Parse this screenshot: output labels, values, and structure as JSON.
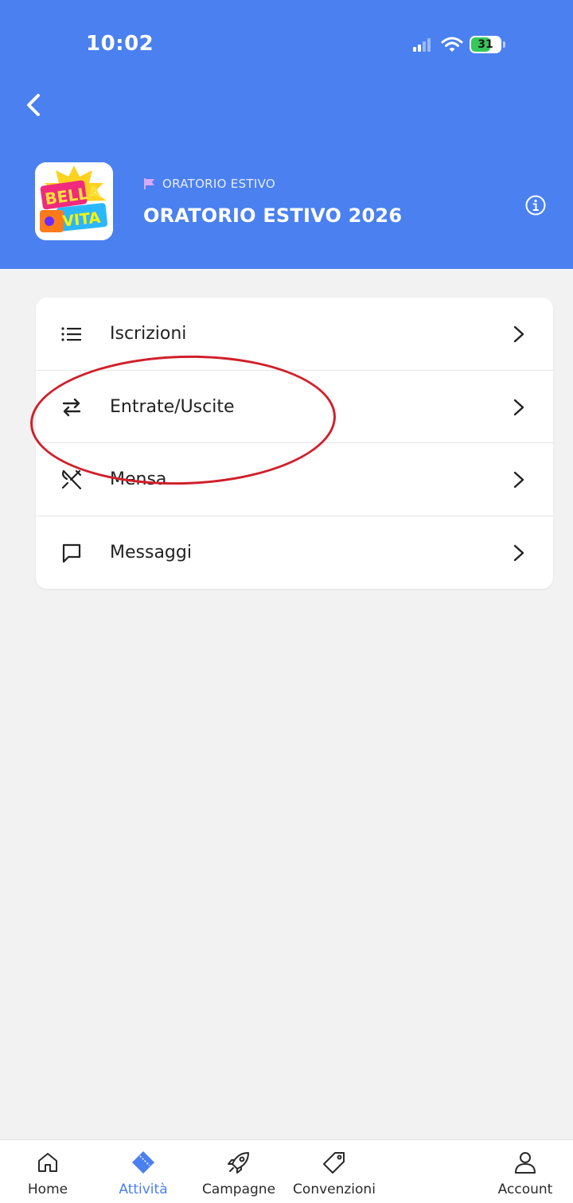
{
  "status_bar": {
    "time": "10:02",
    "battery": "31"
  },
  "header": {
    "org_label": "ORATORIO ESTIVO",
    "title": "ORATORIO ESTIVO 2026",
    "logo_text": "BELLA VITA"
  },
  "menu": {
    "items": [
      {
        "label": "Iscrizioni",
        "icon": "list-icon"
      },
      {
        "label": "Entrate/Uscite",
        "icon": "swap-arrows-icon"
      },
      {
        "label": "Mensa",
        "icon": "cutlery-icon"
      },
      {
        "label": "Messaggi",
        "icon": "message-icon"
      }
    ]
  },
  "bottom_nav": {
    "items": [
      {
        "label": "Home",
        "icon": "home-icon"
      },
      {
        "label": "Attività",
        "icon": "ticket-icon",
        "active": true
      },
      {
        "label": "Campagne",
        "icon": "rocket-icon"
      },
      {
        "label": "Convenzioni",
        "icon": "tag-icon"
      },
      {
        "label": "Account",
        "icon": "user-icon"
      }
    ]
  },
  "colors": {
    "primary": "#4a80f0",
    "annotation": "#d0202a",
    "flag": "#d9a8ff"
  }
}
